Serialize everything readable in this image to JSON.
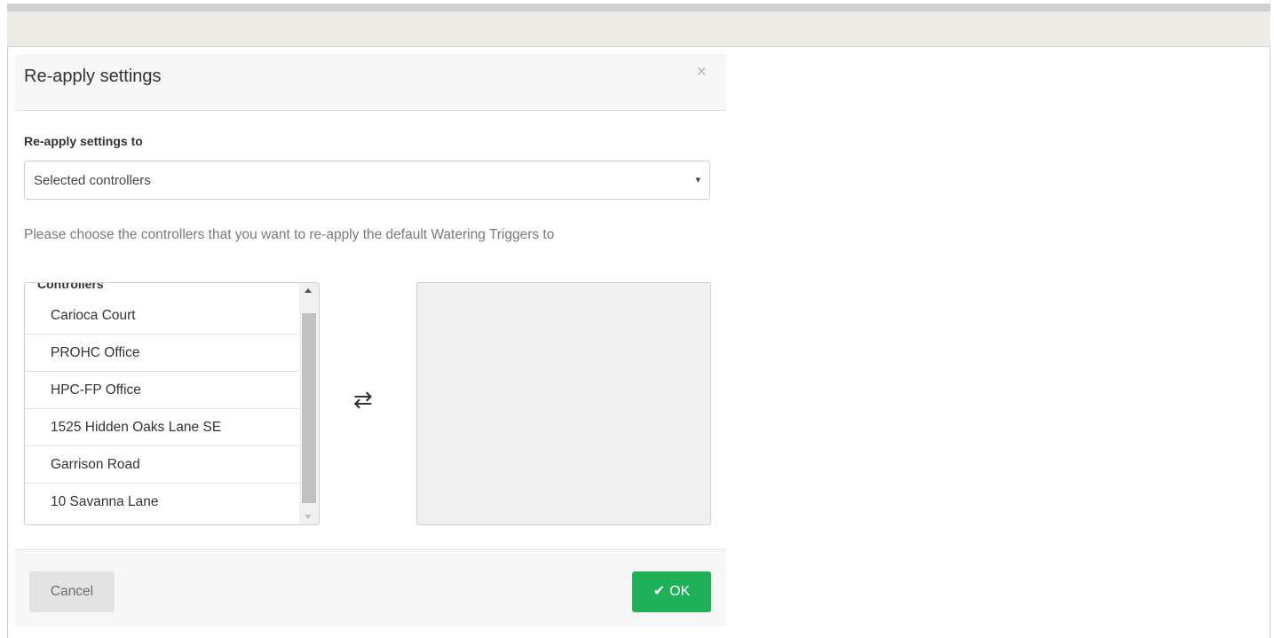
{
  "modal": {
    "title": "Re-apply settings",
    "close_icon": "×"
  },
  "form": {
    "label": "Re-apply settings to",
    "select": {
      "selected": "Selected controllers",
      "caret": "▾"
    },
    "help_text": "Please choose the controllers that you want to re-apply the default Watering Triggers to"
  },
  "source_list": {
    "group_label": "Controllers",
    "items": [
      "Carioca Court",
      "PROHC Office",
      "HPC-FP Office",
      "1525 Hidden Oaks Lane SE",
      "Garrison Road",
      "10 Savanna Lane"
    ]
  },
  "transfer_icon": "⇄",
  "footer": {
    "cancel_label": "Cancel",
    "ok_label": "OK",
    "ok_icon": "✔",
    "ok_color": "#1fb158"
  }
}
